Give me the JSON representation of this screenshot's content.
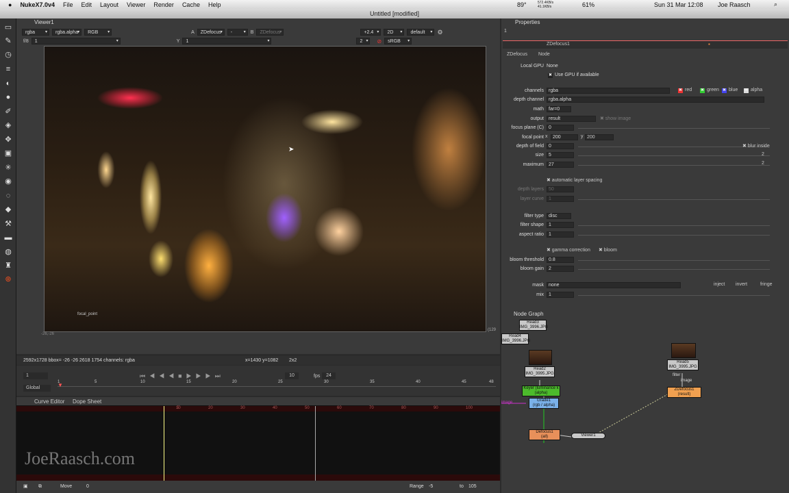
{
  "menubar": {
    "app": "NukeX7.0v4",
    "items": [
      "File",
      "Edit",
      "Layout",
      "Viewer",
      "Render",
      "Cache",
      "Help"
    ],
    "battery": "61%",
    "temp": "89°",
    "net_up": "572.4KB/s",
    "net_down": "41.1KB/s",
    "clock": "Sun 31 Mar 12:08",
    "user": "Joe Raasch"
  },
  "window": {
    "title": "Untitled [modified]"
  },
  "viewer": {
    "tab": "Viewer1",
    "channels": "rgba",
    "channel2": "rgba.alpha",
    "display": "RGB",
    "input_a_label": "A",
    "input_a": "ZDefocus",
    "op": "-",
    "input_b_label": "B",
    "input_b": "ZDefocus",
    "gain": "+2.4",
    "mode": "2D",
    "lut": "default",
    "fstop": "f/8",
    "frame": "1",
    "y_label": "Y",
    "y_value": "1",
    "proxy": "2",
    "colorspace": "sRGB",
    "corner_label": "-26,-26",
    "right_label": "(129",
    "focal_label": "focal_point"
  },
  "status": {
    "info": "2592x1728 bbox= -26 -26 2618 1754 channels: rgba",
    "coords": "x=1430 y=1082",
    "zoom": "2x2"
  },
  "timeline": {
    "frame": "1",
    "playframe": "10",
    "fps_label": "fps",
    "fps": "24",
    "scope": "Global",
    "ticks": [
      "1",
      "5",
      "10",
      "15",
      "20",
      "25",
      "30",
      "35",
      "40",
      "45",
      "48"
    ]
  },
  "curve": {
    "tabs": [
      "Curve Editor",
      "Dope Sheet"
    ],
    "ticks": [
      "5",
      "10",
      "20",
      "30",
      "40",
      "50",
      "60",
      "70",
      "80",
      "90",
      "100"
    ]
  },
  "bottombar": {
    "mode": "Move",
    "value": "0",
    "range_label": "Range",
    "range_start": "-5",
    "to_label": "to",
    "range_end": "105"
  },
  "properties": {
    "tab": "Properties",
    "count": "1",
    "node": "ZDefocus1",
    "subtabs": [
      "ZDefocus",
      "Node"
    ],
    "rows": [
      {
        "label": "Local GPU",
        "value": "None"
      },
      {
        "label": "",
        "value": "Use GPU if available"
      },
      {
        "label": "channels",
        "value": "rgba"
      },
      {
        "label": "depth channel",
        "value": "rgba.alpha"
      },
      {
        "label": "math",
        "value": "far=0"
      },
      {
        "label": "output",
        "value": "result"
      },
      {
        "label": "focus plane (C)",
        "value": "0"
      },
      {
        "label": "focal point",
        "value": "200"
      },
      {
        "label": "depth of field",
        "value": "0"
      },
      {
        "label": "size",
        "value": "5"
      },
      {
        "label": "maximum",
        "value": "27"
      },
      {
        "label": "depth layers",
        "value": "50"
      },
      {
        "label": "layer curve",
        "value": "1"
      },
      {
        "label": "filter type",
        "value": "disc"
      },
      {
        "label": "filter shape",
        "value": "1"
      },
      {
        "label": "aspect ratio",
        "value": "1"
      },
      {
        "label": "bloom threshold",
        "value": "0.8"
      },
      {
        "label": "bloom gain",
        "value": "2"
      },
      {
        "label": "mask",
        "value": "none"
      },
      {
        "label": "mix",
        "value": "1"
      }
    ],
    "channel_checks": [
      "red",
      "green",
      "blue",
      "alpha"
    ],
    "show_image": "show image",
    "focal_x_label": "x",
    "focal_y_label": "y",
    "focal_y": "200",
    "blur_inside": "blur inside",
    "size_right": "2",
    "maximum_right": "2",
    "auto_layer": "automatic layer spacing",
    "gamma": "gamma correction",
    "bloom": "bloom",
    "mask_opts": [
      "inject",
      "invert",
      "fringe"
    ]
  },
  "nodegraph": {
    "tab": "Node Graph",
    "nodes": [
      {
        "label": "Read3",
        "sub": "IMG_3996.JPG"
      },
      {
        "label": "Read4",
        "sub": "IMG_3996.JPG"
      },
      {
        "label": "Read2",
        "sub": "IMG_3995.JPG"
      },
      {
        "label": "Keyer (luminance k",
        "sub": "(alpha)"
      },
      {
        "label": "Grade1",
        "sub": "(rgb / alpha)"
      },
      {
        "label": "Defocus1",
        "sub": "(all)"
      },
      {
        "label": "Viewer1",
        "sub": ""
      },
      {
        "label": "Read5",
        "sub": "IMG_3995.JPG"
      },
      {
        "label": "ZDefocus1",
        "sub": "(result)"
      }
    ],
    "pipe_labels": [
      "image",
      "filter",
      "image"
    ]
  },
  "watermark": "JoeRaasch.com",
  "colors": {
    "accent": "#f08020",
    "keyer": "#4cbb2c",
    "grade": "#7ab0e8",
    "defocus": "#e8905a",
    "read": "#c8c8c8"
  }
}
